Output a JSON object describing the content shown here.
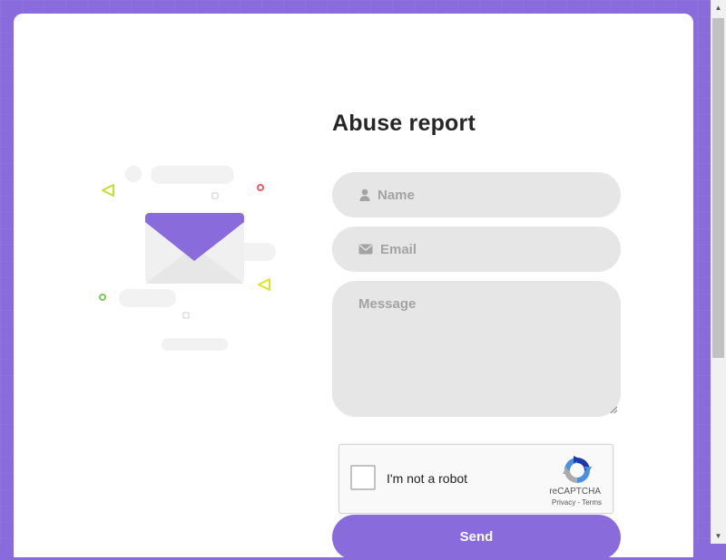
{
  "form": {
    "title": "Abuse report",
    "name_placeholder": "Name",
    "email_placeholder": "Email",
    "message_placeholder": "Message",
    "send_label": "Send"
  },
  "recaptcha": {
    "label": "I'm not a robot",
    "brand": "reCAPTCHA",
    "privacy": "Privacy",
    "separator": " - ",
    "terms": "Terms"
  },
  "icons": {
    "name_field": "user-icon",
    "email_field": "envelope-icon",
    "illustration": "envelope-illustration-icon"
  },
  "colors": {
    "accent": "#8a6bdc",
    "field_bg": "#e6e6e6",
    "placeholder": "#a3a3a3",
    "title": "#262626"
  }
}
